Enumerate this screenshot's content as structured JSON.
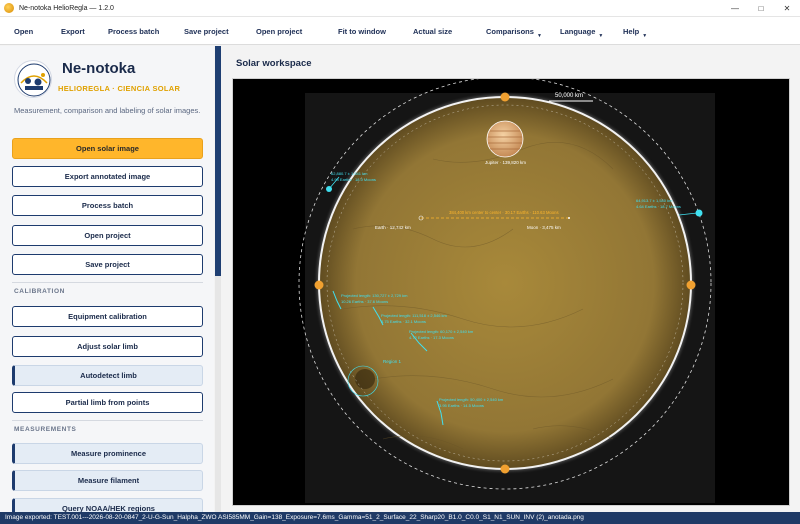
{
  "window": {
    "title": "Ne-notoka HelioRegla — 1.2.0"
  },
  "menubar": {
    "items": [
      {
        "label": "Open",
        "dropdown": false
      },
      {
        "label": "Export",
        "dropdown": false
      },
      {
        "label": "Process batch",
        "dropdown": false
      },
      {
        "label": "Save project",
        "dropdown": false
      },
      {
        "label": "Open project",
        "dropdown": false
      },
      {
        "label": "Fit to window",
        "dropdown": false
      },
      {
        "label": "Actual size",
        "dropdown": false
      },
      {
        "label": "Comparisons",
        "dropdown": true
      },
      {
        "label": "Language",
        "dropdown": true
      },
      {
        "label": "Help",
        "dropdown": true
      }
    ]
  },
  "sidebar": {
    "brand": "Ne-notoka",
    "subtitle": "HELIOREGLA · CIENCIA SOLAR",
    "description": "Measurement, comparison and labeling of solar images.",
    "buttons": {
      "open_solar_image": "Open solar image",
      "export_annotated": "Export annotated image",
      "process_batch": "Process batch",
      "open_project": "Open project",
      "save_project": "Save project"
    },
    "calibration": {
      "heading": "CALIBRATION",
      "equipment": "Equipment calibration",
      "adjust_limb": "Adjust solar limb",
      "autodetect": "Autodetect limb",
      "partial_limb": "Partial limb from points"
    },
    "measurements": {
      "heading": "MEASUREMENTS",
      "prominence": "Measure prominence",
      "filament": "Measure filament",
      "noaa": "Query NOAA/HEK regions"
    }
  },
  "workspace": {
    "title": "Solar workspace",
    "scale_label": "50,000 km",
    "jupiter_label": "Jupiter · 139,820 km",
    "earth_label": "Earth · 12,742 km",
    "moon_label": "Moon · 3,475 km",
    "distance_label": "384,400 km center to center · 30.17 Earths · 110.63 Moons",
    "region_label": "Region 1",
    "prominence_left": [
      "62,880.7 ± 1,541 km",
      "4.93 Earths · 18.0 Moons"
    ],
    "prominence_right": [
      "64,913.7 ± 1,540 km",
      "4.64 Earths · 18.7 Moons"
    ],
    "filament_1": [
      "Projected length: 130,727 ± 2,729 km",
      "10.26 Earths · 37.6 Moons"
    ],
    "filament_2": [
      "Projected length: 111,518 ± 2,546 km",
      "8.75 Earths · 32.1 Moons"
    ],
    "filament_3": [
      "Projected length: 60,170 ± 2,540 km",
      "4.72 Earths · 17.3 Moons"
    ],
    "filament_4": [
      "Projected length: 50,400 ± 2,540 km",
      "3.95 Earths · 14.5 Moons"
    ]
  },
  "statusbar": {
    "text": "Image exported: TEST.001---2026-08-20-0847_2-U-G-Sun_Halpha_ZWO ASI585MM_Gain=138_Exposure=7.6ms_Gamma=51_2_Surface_22_Sharp20_B1.0_C0.0_S1_N1_SUN_INV (2)_anotada.png"
  },
  "colors": {
    "accent": "#ffb62b",
    "navy": "#1d3b6e",
    "annotation": "#40e0f0",
    "handle": "#f0a030",
    "sun": "#b89a3a"
  }
}
